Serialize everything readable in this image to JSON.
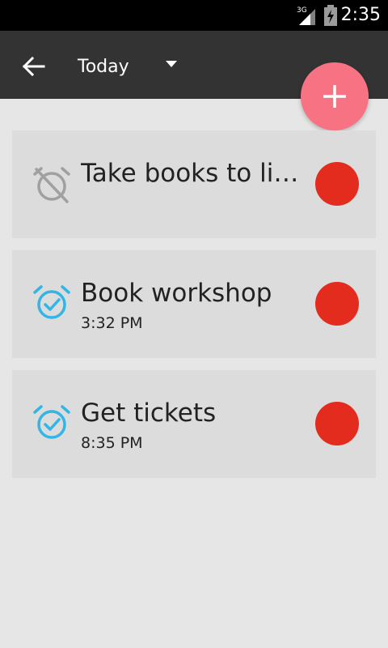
{
  "status_bar": {
    "network": "3G",
    "time": "2:35",
    "icons": [
      "signal-3g-icon",
      "battery-charging-icon"
    ]
  },
  "appbar": {
    "title": "Today",
    "back_icon": "arrow-back-icon",
    "dropdown_icon": "dropdown-triangle-icon",
    "add_icon": "plus-icon",
    "background": "#333333",
    "fab_color": "#f77283"
  },
  "tasks": [
    {
      "title": "Take books to library",
      "time": "",
      "alarm": "alarm-off-icon",
      "priority_color": "#e32b1e"
    },
    {
      "title": "Book workshop",
      "time": "3:32 PM",
      "alarm": "alarm-on-icon",
      "priority_color": "#e32b1e"
    },
    {
      "title": "Get tickets",
      "time": "8:35 PM",
      "alarm": "alarm-on-icon",
      "priority_color": "#e32b1e"
    }
  ],
  "colors": {
    "background": "#e6e6e6",
    "card": "#dcdcdc",
    "alarm_on": "#33b5e5",
    "alarm_off": "#a0a0a0"
  }
}
